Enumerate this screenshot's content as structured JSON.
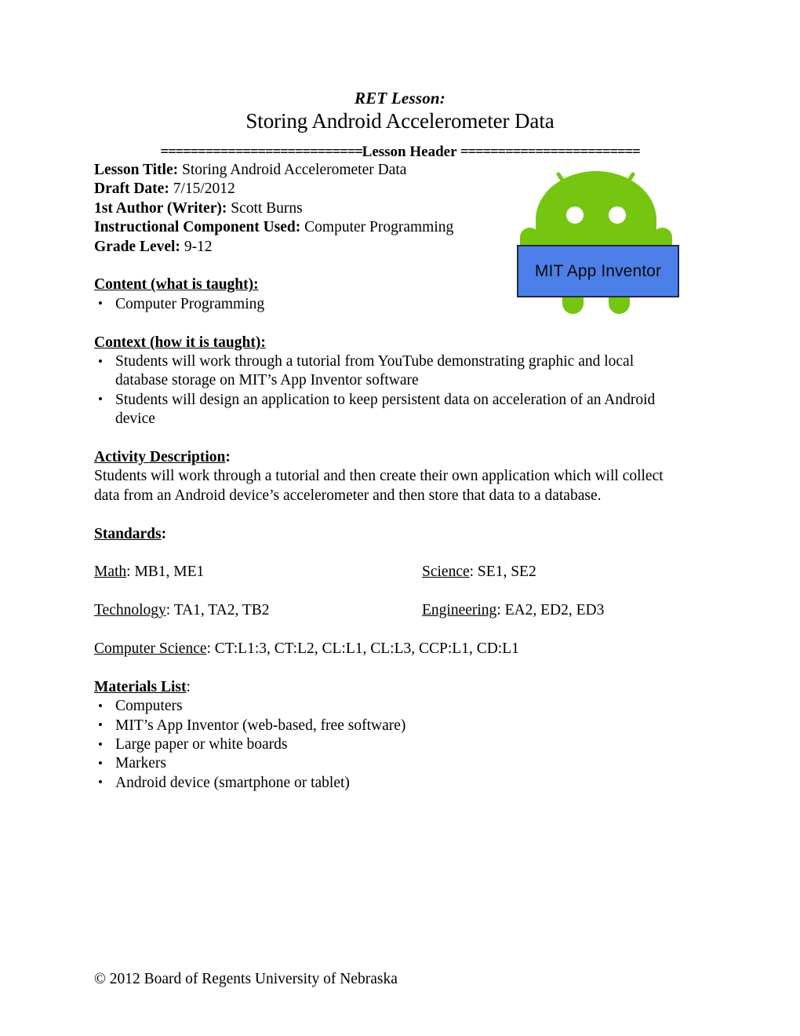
{
  "document": {
    "ret_lesson_label": "RET Lesson:",
    "title": "Storing Android Accelerometer Data",
    "header_rule": {
      "left_equals": "===========================",
      "label": "Lesson Header",
      "right_equals": "========================"
    }
  },
  "metadata": [
    {
      "label": "Lesson Title:",
      "value": " Storing Android Accelerometer Data"
    },
    {
      "label": "Draft Date:",
      "value": " 7/15/2012"
    },
    {
      "label": "1st Author (Writer):",
      "value": " Scott Burns"
    },
    {
      "label": "Instructional Component Used:",
      "value": " Computer Programming"
    },
    {
      "label": "Grade Level:",
      "value": " 9-12"
    }
  ],
  "sections": {
    "content": {
      "heading": "Content (what is taught):",
      "items": [
        "Computer Programming"
      ]
    },
    "context": {
      "heading": "Context (how it is taught):",
      "items": [
        "Students will work through a tutorial from YouTube demonstrating graphic and local database storage on MIT’s App Inventor software",
        "Students will design an application to keep persistent data on acceleration of an Android device"
      ]
    },
    "activity_description": {
      "heading": "Activity Description",
      "heading_suffix": ":",
      "paragraph": "Students will work through a tutorial and then create their own application which will collect data from an Android device’s accelerometer and then store that data to a database."
    },
    "standards": {
      "heading": "Standards",
      "heading_suffix": ":",
      "rows": [
        {
          "left_label": "Math",
          "left_value": ": MB1, ME1",
          "right_label": "Science",
          "right_value": ": SE1, SE2"
        },
        {
          "left_label": "Technology",
          "left_value": ": TA1, TA2, TB2",
          "right_label": "Engineering",
          "right_value": ": EA2, ED2, ED3"
        },
        {
          "left_label": "Computer Science",
          "left_value": ": CT:L1:3, CT:L2, CL:L1, CL:L3, CCP:L1, CD:L1",
          "right_label": "",
          "right_value": ""
        }
      ]
    },
    "materials_list": {
      "heading": "Materials List",
      "heading_suffix": ":",
      "items": [
        "Computers",
        "MIT’s App Inventor (web-based, free software)",
        "Large paper or white boards",
        "Markers",
        "Android device (smartphone or tablet)"
      ]
    }
  },
  "logo": {
    "caption": "MIT App Inventor",
    "robot_color": "#76C511",
    "banner_color": "#4C7FE8",
    "banner_border_color": "#1b2a45",
    "eye_color": "#ffffff"
  },
  "footer": {
    "copyright": "© 2012 Board of Regents University of Nebraska"
  }
}
